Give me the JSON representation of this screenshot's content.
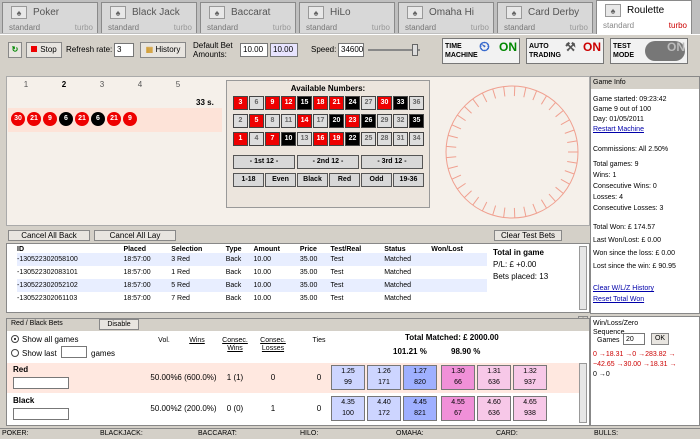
{
  "tabs": [
    {
      "name": "Poker",
      "standard": "standard",
      "turbo": "turbo"
    },
    {
      "name": "Black Jack",
      "standard": "standard",
      "turbo": "turbo"
    },
    {
      "name": "Baccarat",
      "standard": "standard",
      "turbo": "turbo"
    },
    {
      "name": "HiLo",
      "standard": "standard",
      "turbo": "turbo"
    },
    {
      "name": "Omaha Hi",
      "standard": "standard",
      "turbo": "turbo"
    },
    {
      "name": "Card Derby",
      "standard": "standard",
      "turbo": "turbo"
    },
    {
      "name": "Roulette",
      "standard": "standard",
      "turbo": "turbo"
    }
  ],
  "toolbar": {
    "stop": "Stop",
    "refresh_label": "Refresh rate:",
    "refresh_value": "3",
    "history": "History",
    "default_bet_label": "Default Bet Amounts:",
    "bet1": "10.00",
    "bet2": "10.00",
    "speed_label": "Speed:",
    "speed_value": "34600",
    "time_machine": "TIME MACHINE",
    "time_machine_state": "ON",
    "auto_trading": "AUTO TRADING",
    "auto_trading_state": "ON",
    "test_mode": "TEST MODE",
    "test_mode_state": "ON"
  },
  "rounds": {
    "tabs": [
      "1",
      "2",
      "3",
      "4",
      "5"
    ],
    "timer": "33 s.",
    "results": [
      {
        "n": "30",
        "c": "r"
      },
      {
        "n": "21",
        "c": "r"
      },
      {
        "n": "9",
        "c": "r"
      },
      {
        "n": "6",
        "c": "k"
      },
      {
        "n": "21",
        "c": "r"
      },
      {
        "n": "6",
        "c": "k"
      },
      {
        "n": "21",
        "c": "r"
      },
      {
        "n": "9",
        "c": "r"
      }
    ]
  },
  "board": {
    "title": "Available Numbers:",
    "rows": [
      [
        {
          "n": "3",
          "c": "r"
        },
        {
          "n": "6",
          "c": "g"
        },
        {
          "n": "9",
          "c": "r"
        },
        {
          "n": "12",
          "c": "r"
        },
        {
          "n": "15",
          "c": "k"
        },
        {
          "n": "18",
          "c": "r"
        },
        {
          "n": "21",
          "c": "r"
        },
        {
          "n": "24",
          "c": "k"
        },
        {
          "n": "27",
          "c": "g"
        },
        {
          "n": "30",
          "c": "r"
        },
        {
          "n": "33",
          "c": "k"
        },
        {
          "n": "36",
          "c": "g"
        }
      ],
      [
        {
          "n": "2",
          "c": "g"
        },
        {
          "n": "5",
          "c": "r"
        },
        {
          "n": "8",
          "c": "g"
        },
        {
          "n": "11",
          "c": "g"
        },
        {
          "n": "14",
          "c": "r"
        },
        {
          "n": "17",
          "c": "g"
        },
        {
          "n": "20",
          "c": "k"
        },
        {
          "n": "23",
          "c": "r"
        },
        {
          "n": "26",
          "c": "k"
        },
        {
          "n": "29",
          "c": "g"
        },
        {
          "n": "32",
          "c": "g"
        },
        {
          "n": "35",
          "c": "k"
        }
      ],
      [
        {
          "n": "1",
          "c": "r"
        },
        {
          "n": "4",
          "c": "g"
        },
        {
          "n": "7",
          "c": "r"
        },
        {
          "n": "10",
          "c": "k"
        },
        {
          "n": "13",
          "c": "g"
        },
        {
          "n": "16",
          "c": "r"
        },
        {
          "n": "19",
          "c": "r"
        },
        {
          "n": "22",
          "c": "k"
        },
        {
          "n": "25",
          "c": "g"
        },
        {
          "n": "28",
          "c": "g"
        },
        {
          "n": "31",
          "c": "g"
        },
        {
          "n": "34",
          "c": "g"
        }
      ]
    ],
    "dozens": [
      "- 1st 12 -",
      "- 2nd 12 -",
      "- 3rd 12 -"
    ],
    "outside": [
      "1-18",
      "Even",
      "Black",
      "Red",
      "Odd",
      "19-36"
    ]
  },
  "info": {
    "title": "Game Info",
    "started": "Game started: 09:23:42",
    "game": "Game 9 out of 100",
    "day": "Day: 01/05/2011",
    "restart": "Restart Machine",
    "commissions": "Commissions: All 2.50%",
    "total_games": "Total games: 9",
    "wins": "Wins: 1",
    "cons_wins": "Consecutive Wins: 0",
    "losses": "Losses: 4",
    "cons_losses": "Consecutive Losses: 3",
    "total_won": "Total Won: £ 174.57",
    "last_won_lost": "Last Won/Lost: £ 0.00",
    "won_since_loss": "Won since the loss: £ 0.00",
    "lost_since_win": "Lost since the win: £ 90.95",
    "clear_history": "Clear W/L/Z History",
    "reset_total": "Reset Total Won",
    "wlz_label": "Win/Loss/Zero Sequence",
    "games_label": "Games",
    "games_value": "20",
    "ok": "OK",
    "seq1": "0 →18.31 →0 →283.82 →",
    "seq2": "−42.65 →30.00 →18.31 →",
    "seq3": "0 →0"
  },
  "bets": {
    "cancel_back": "Cancel All Back",
    "cancel_lay": "Cancel All Lay",
    "clear_test": "Clear Test Bets",
    "columns": [
      "ID",
      "Placed",
      "Selection",
      "Type",
      "Amount",
      "Price",
      "Test/Real",
      "Status",
      "Won/Lost"
    ],
    "rows": [
      [
        "-130522302058100",
        "18:57:00",
        "3 Red",
        "Back",
        "10.00",
        "35.00",
        "Test",
        "Matched",
        ""
      ],
      [
        "-130522302083101",
        "18:57:00",
        "1 Red",
        "Back",
        "10.00",
        "35.00",
        "Test",
        "Matched",
        ""
      ],
      [
        "-130522302052102",
        "18:57:00",
        "5 Red",
        "Back",
        "10.00",
        "35.00",
        "Test",
        "Matched",
        ""
      ],
      [
        "-130522302061103",
        "18:57:00",
        "7 Red",
        "Back",
        "10.00",
        "35.00",
        "Test",
        "Matched",
        ""
      ]
    ],
    "total_label": "Total in game",
    "pl": "P/L: £ +0.00",
    "placed": "Bets placed: 13"
  },
  "market": {
    "title": "Red / Black Bets",
    "disable": "Disable",
    "show_all": "Show all games",
    "show_last": "Show last",
    "games": "games",
    "headers": [
      "Vol.",
      "Wins",
      "Consec. Wins",
      "Consec. Losses",
      "Ties"
    ],
    "total_matched": "Total Matched: £ 2000.00",
    "pct1": "101.21 %",
    "pct2": "98.90 %",
    "rows": [
      {
        "name": "Red",
        "vol": "50.00%",
        "wins": "6 (600.0%)",
        "cw": "1 (1)",
        "cl": "0",
        "ties": "0",
        "back": [
          [
            "1.25",
            "99"
          ],
          [
            "1.26",
            "171"
          ],
          [
            "1.27",
            "820"
          ]
        ],
        "lay": [
          [
            "1.30",
            "66"
          ],
          [
            "1.31",
            "636"
          ],
          [
            "1.32",
            "937"
          ]
        ]
      },
      {
        "name": "Black",
        "vol": "50.00%",
        "wins": "2 (200.0%)",
        "cw": "0 (0)",
        "cl": "1",
        "ties": "0",
        "back": [
          [
            "4.35",
            "100"
          ],
          [
            "4.40",
            "172"
          ],
          [
            "4.45",
            "821"
          ]
        ],
        "lay": [
          [
            "4.55",
            "67"
          ],
          [
            "4.60",
            "636"
          ],
          [
            "4.65",
            "938"
          ]
        ]
      }
    ]
  },
  "statusbar": [
    "POKER:",
    "BLACKJACK:",
    "BACCARAT:",
    "HILO:",
    "OMAHA:",
    "CARD:",
    "BULLS:"
  ]
}
